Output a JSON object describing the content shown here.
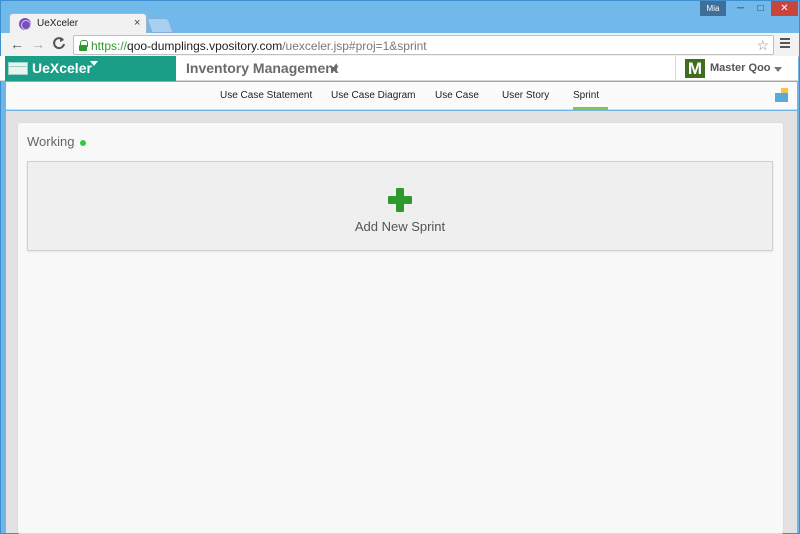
{
  "browser": {
    "tab_title": "UeXceler",
    "tab_close": "×",
    "user_badge": "Mia",
    "url_scheme": "https://",
    "url_host": "qoo-dumplings.vpository.com",
    "url_path": "/uexceler.jsp#proj=1&sprint",
    "window_controls": {
      "minimize": "─",
      "maximize": "□",
      "close": "✕"
    },
    "nav_icons": {
      "back": "←",
      "forward": "→",
      "reload": "C",
      "star": "☆"
    }
  },
  "app": {
    "brand_name": "UeXceler",
    "project_name": "Inventory Management",
    "user_initial": "M",
    "user_name": "Master Qoo",
    "brand_color": "#1a9e87"
  },
  "tabs": [
    {
      "label": "Use Case Statement",
      "active": false
    },
    {
      "label": "Use Case Diagram",
      "active": false
    },
    {
      "label": "Use Case",
      "active": false
    },
    {
      "label": "User Story",
      "active": false
    },
    {
      "label": "Sprint",
      "active": true
    }
  ],
  "main": {
    "section_title": "Working",
    "status_color": "#2ecc40",
    "add_sprint_label": "Add New Sprint",
    "add_icon": "plus-icon"
  }
}
